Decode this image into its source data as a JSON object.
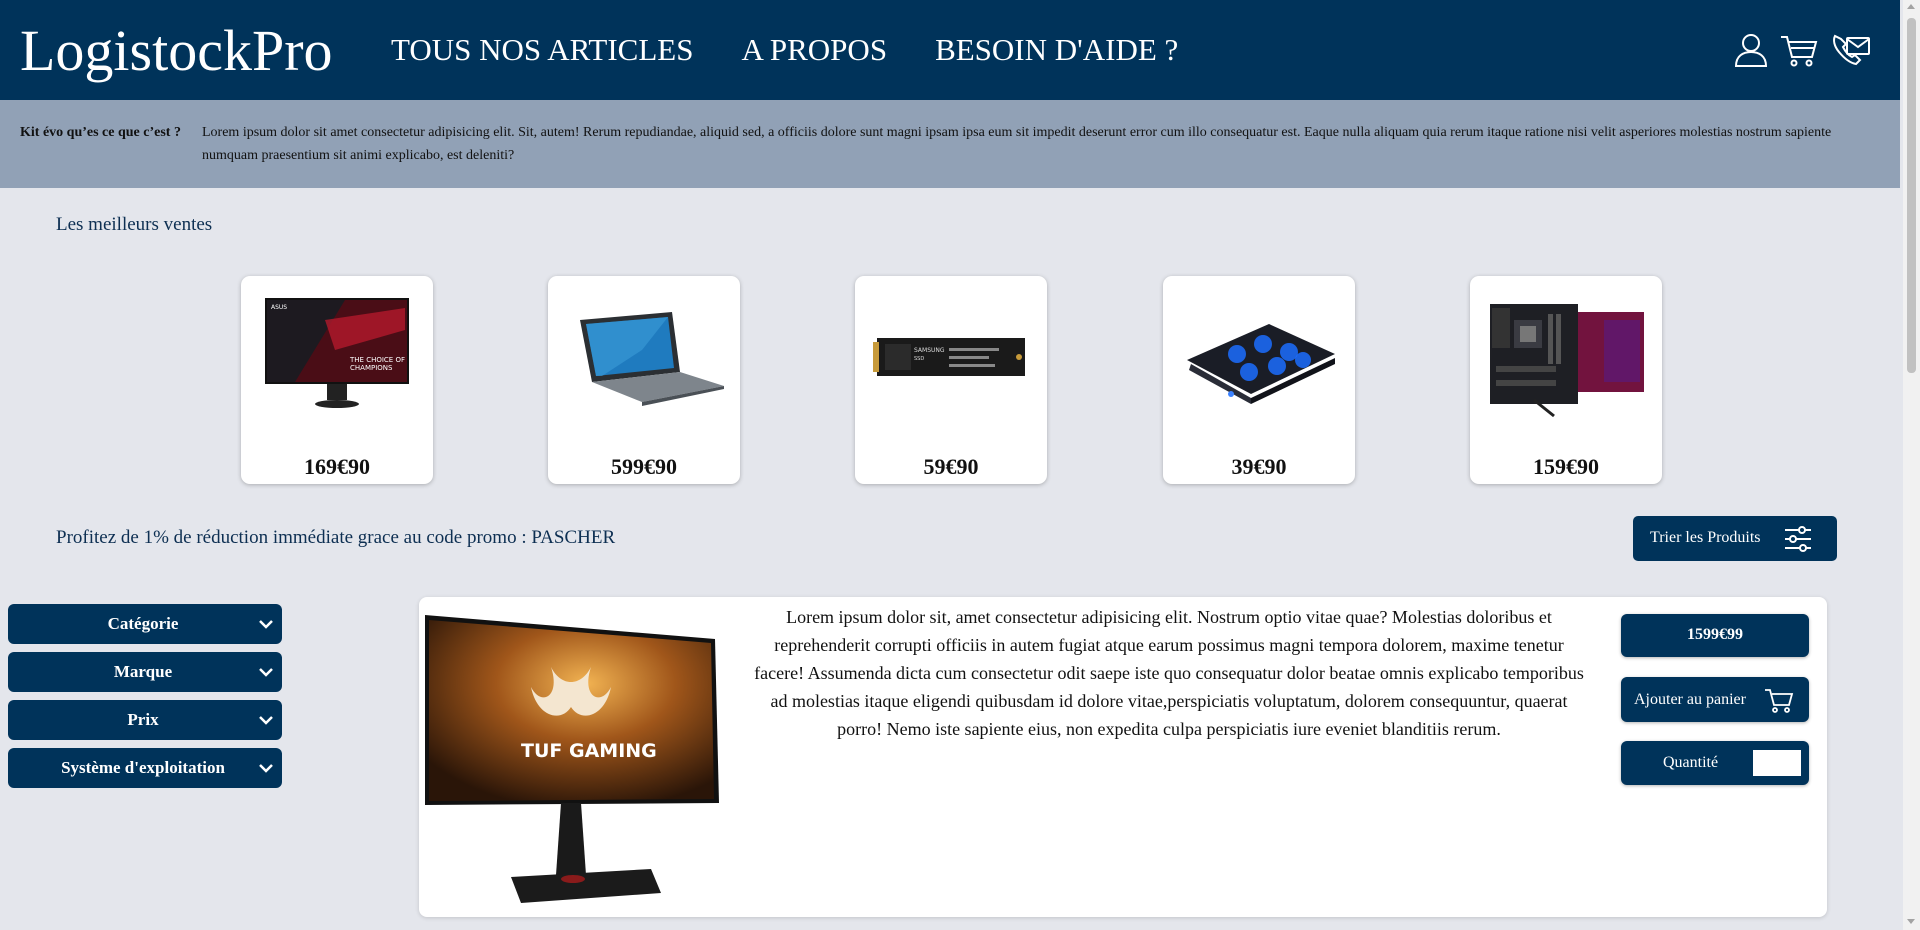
{
  "header": {
    "logo": "LogistockPro",
    "nav": [
      "TOUS NOS ARTICLES",
      "A PROPOS",
      "BESOIN D'AIDE ?"
    ],
    "icons": [
      "user-icon",
      "cart-icon",
      "contact-icon"
    ]
  },
  "info": {
    "title": "Kit évo qu’es ce que c’est ?",
    "text": "Lorem ipsum dolor sit amet consectetur adipisicing elit. Sit, autem! Rerum repudiandae, aliquid sed, a officiis dolore sunt magni ipsam ipsa eum sit impedit deserunt error cum illo consequatur est. Eaque nulla aliquam quia rerum itaque ratione nisi velit asperiores molestias nostrum sapiente numquam praesentium sit animi explicabo, est deleniti?"
  },
  "bestsellers": {
    "title": "Les meilleurs ventes",
    "items": [
      {
        "price": "169€90",
        "image": "monitor-image"
      },
      {
        "price": "599€90",
        "image": "laptop-image"
      },
      {
        "price": "59€90",
        "image": "ssd-image"
      },
      {
        "price": "39€90",
        "image": "cooling-pad-image"
      },
      {
        "price": "159€90",
        "image": "motherboard-image"
      }
    ]
  },
  "promo": {
    "text": "Profitez de 1% de réduction immédiate grace au code promo : PASCHER"
  },
  "sort_button": {
    "label": "Trier les Produits",
    "icon": "sliders-icon"
  },
  "filters": [
    "Catégorie",
    "Marque",
    "Prix",
    "Système d'exploitation"
  ],
  "product": {
    "description": "Lorem ipsum dolor sit, amet consectetur adipisicing elit. Nostrum optio vitae quae? Molestias doloribus et reprehenderit corrupti officiis in autem fugiat atque earum possimus magni tempora dolorem, maxime tenetur facere! Assumenda dicta cum consectetur odit saepe iste quo consequatur dolor beatae omnis explicabo temporibus ad molestias itaque eligendi quibusdam id dolore vitae,perspiciatis voluptatum, dolorem consequuntur, quaerat porro! Nemo iste sapiente eius, non expedita culpa perspiciatis iure eveniet blanditiis rerum.",
    "price": "1599€99",
    "add_to_cart": "Ajouter au panier",
    "quantity_label": "Quantité",
    "quantity_value": "",
    "image_text": "TUF GAMING"
  },
  "colors": {
    "primary": "#00335a",
    "info_bar": "#91a1b6",
    "background": "#e4e6ec"
  }
}
